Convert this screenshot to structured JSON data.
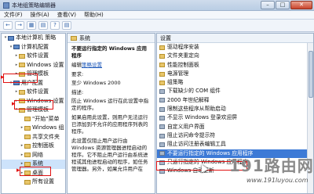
{
  "window": {
    "title": "本地组策略编辑器",
    "min": "–",
    "max": "□",
    "close": "✕"
  },
  "menu": [
    "文件(F)",
    "操作(A)",
    "查看(V)",
    "帮助(H)"
  ],
  "toolbar": [
    "←",
    "→",
    "▦",
    "▤",
    "?",
    "▤"
  ],
  "tree": [
    {
      "label": "本地计算机 策略",
      "indent": 0,
      "exp": "▾",
      "icon": "computer-icon"
    },
    {
      "label": "计算机配置",
      "indent": 1,
      "exp": "▾",
      "icon": "computer-icon"
    },
    {
      "label": "软件设置",
      "indent": 2,
      "exp": "▸",
      "icon": "folder-icon"
    },
    {
      "label": "Windows 设置",
      "indent": 2,
      "exp": "▸",
      "icon": "folder-icon"
    },
    {
      "label": "管理模板",
      "indent": 2,
      "exp": "▸",
      "icon": "folder-icon"
    },
    {
      "label": "用户配置",
      "indent": 1,
      "exp": "▾",
      "icon": "computer-icon"
    },
    {
      "label": "软件设置",
      "indent": 2,
      "exp": "▸",
      "icon": "folder-icon"
    },
    {
      "label": "Windows 设置",
      "indent": 2,
      "exp": "▸",
      "icon": "folder-icon"
    },
    {
      "label": "管理模板",
      "indent": 2,
      "exp": "▾",
      "icon": "folder-icon"
    },
    {
      "label": "\"开始\"菜单",
      "indent": 3,
      "exp": "",
      "icon": "folder-icon"
    },
    {
      "label": "Windows 组",
      "indent": 3,
      "exp": "▸",
      "icon": "folder-icon"
    },
    {
      "label": "共享文件夹",
      "indent": 3,
      "exp": "",
      "icon": "folder-icon"
    },
    {
      "label": "控制面板",
      "indent": 3,
      "exp": "▸",
      "icon": "folder-icon"
    },
    {
      "label": "网络",
      "indent": 3,
      "exp": "▸",
      "icon": "folder-icon"
    },
    {
      "label": "系统",
      "indent": 3,
      "exp": "▸",
      "icon": "folder-icon",
      "selected": true
    },
    {
      "label": "桌面",
      "indent": 3,
      "exp": "▸",
      "icon": "folder-icon"
    },
    {
      "label": "所有设置",
      "indent": 3,
      "exp": "",
      "icon": "folder-icon"
    }
  ],
  "middle": {
    "heading": "系统",
    "policy_title": "不要运行指定的 Windows 应用程序",
    "edit_prefix": "编辑",
    "edit_link": "策略设置",
    "req_label": "要求:",
    "req_value": "至少 Windows 2000",
    "desc_label": "描述:",
    "desc_text": "防止 Windows 运行在此设置中指定的程序。",
    "p1": "如果启用此设置，则用户无法运行已添加到不允许的应用程序列表的程序。",
    "p2": "此设置仅阻止用户运行由 Windows 资源管理器进程启动的程序。它不阻止用户运行由系统进程或其他进程启动的程序，如任务管理器。另外，如果允许用户在"
  },
  "right": {
    "header": "设置",
    "items": [
      {
        "label": "驱动程序安装",
        "icon": "folder-icon"
      },
      {
        "label": "文件夹重定向",
        "icon": "folder-icon"
      },
      {
        "label": "性能控制面板",
        "icon": "folder-icon"
      },
      {
        "label": "电源管理",
        "icon": "folder-icon"
      },
      {
        "label": "组策略",
        "icon": "folder-icon"
      },
      {
        "label": "下载缺少的 COM 组件",
        "icon": "policy-icon"
      },
      {
        "label": "2000 年世纪解释",
        "icon": "policy-icon"
      },
      {
        "label": "限制这些程序从帮助启动",
        "icon": "policy-icon"
      },
      {
        "label": "不显示 Windows 登录欢迎屏",
        "icon": "policy-icon"
      },
      {
        "label": "自定义用户界面",
        "icon": "policy-icon"
      },
      {
        "label": "阻止访问命令提示符",
        "icon": "policy-icon"
      },
      {
        "label": "阻止访问注册表编辑工具",
        "icon": "policy-icon"
      },
      {
        "label": "不要运行指定的 Windows 应用程序",
        "icon": "policy-icon",
        "selected": true
      },
      {
        "label": "只运行指定的 Windows 应用程序",
        "icon": "policy-icon"
      },
      {
        "label": "Windows 自动更新",
        "icon": "policy-icon"
      }
    ]
  },
  "watermark": {
    "text": "路由网",
    "prefix": "191",
    "url": "www.191luyou.com"
  }
}
